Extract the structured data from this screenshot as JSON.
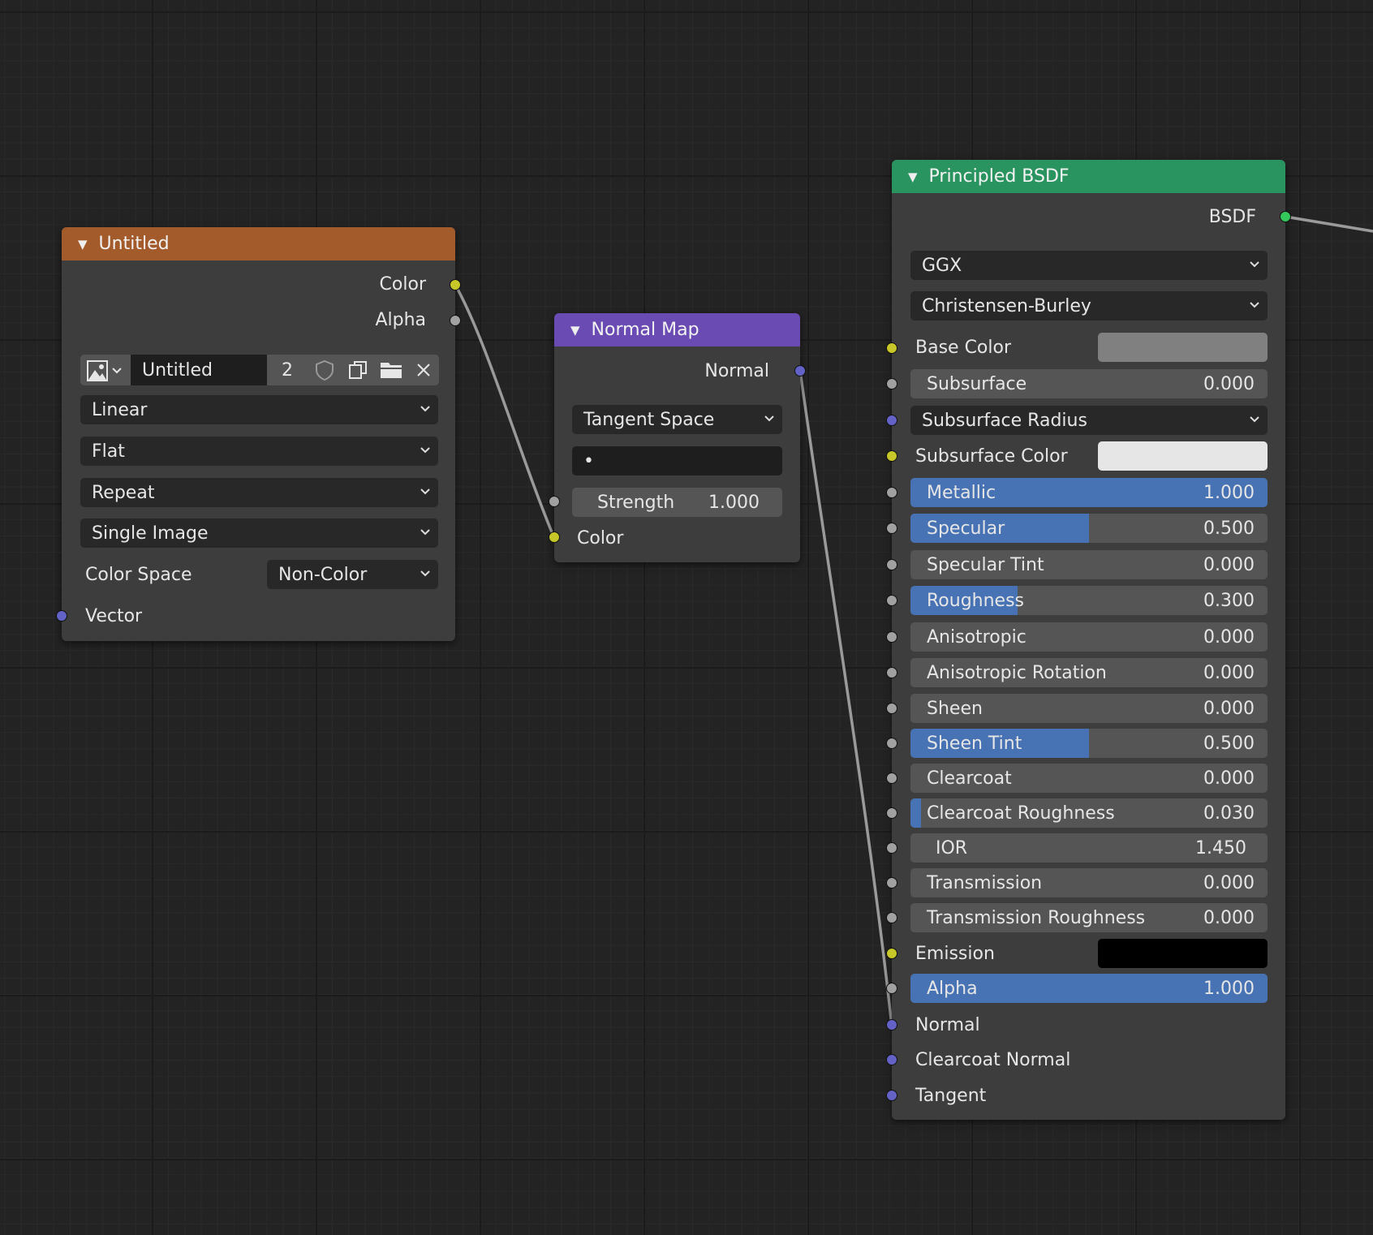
{
  "image_node": {
    "title": "Untitled",
    "outputs": [
      "Color",
      "Alpha"
    ],
    "image_name": "Untitled",
    "users": "2",
    "interpolation": "Linear",
    "projection": "Flat",
    "extension": "Repeat",
    "source": "Single Image",
    "color_space_label": "Color Space",
    "color_space_value": "Non-Color",
    "vector_input": "Vector",
    "header_color": "#a45b2c"
  },
  "normal_map_node": {
    "title": "Normal Map",
    "output": "Normal",
    "space": "Tangent Space",
    "uv_map": "•",
    "strength_label": "Strength",
    "strength_value": "1.000",
    "color_input": "Color",
    "header_color": "#6a4bb3"
  },
  "bsdf_node": {
    "title": "Principled BSDF",
    "output": "BSDF",
    "distribution": "GGX",
    "subsurface_method": "Christensen-Burley",
    "base_color_label": "Base Color",
    "base_color": "#808080",
    "subsurface_label": "Subsurface",
    "subsurface_value": "0.000",
    "subsurface_radius_label": "Subsurface Radius",
    "subsurface_color_label": "Subsurface Color",
    "subsurface_color": "#e6e6e6",
    "metallic_label": "Metallic",
    "metallic_value": "1.000",
    "specular_label": "Specular",
    "specular_value": "0.500",
    "specular_tint_label": "Specular Tint",
    "specular_tint_value": "0.000",
    "roughness_label": "Roughness",
    "roughness_value": "0.300",
    "anisotropic_label": "Anisotropic",
    "anisotropic_value": "0.000",
    "anisotropic_rotation_label": "Anisotropic Rotation",
    "anisotropic_rotation_value": "0.000",
    "sheen_label": "Sheen",
    "sheen_value": "0.000",
    "sheen_tint_label": "Sheen Tint",
    "sheen_tint_value": "0.500",
    "clearcoat_label": "Clearcoat",
    "clearcoat_value": "0.000",
    "clearcoat_roughness_label": "Clearcoat Roughness",
    "clearcoat_roughness_value": "0.030",
    "ior_label": "IOR",
    "ior_value": "1.450",
    "transmission_label": "Transmission",
    "transmission_value": "0.000",
    "transmission_roughness_label": "Transmission Roughness",
    "transmission_roughness_value": "0.000",
    "emission_label": "Emission",
    "emission_color": "#000000",
    "alpha_label": "Alpha",
    "alpha_value": "1.000",
    "normal_label": "Normal",
    "clearcoat_normal_label": "Clearcoat Normal",
    "tangent_label": "Tangent",
    "header_color": "#2a9461"
  }
}
